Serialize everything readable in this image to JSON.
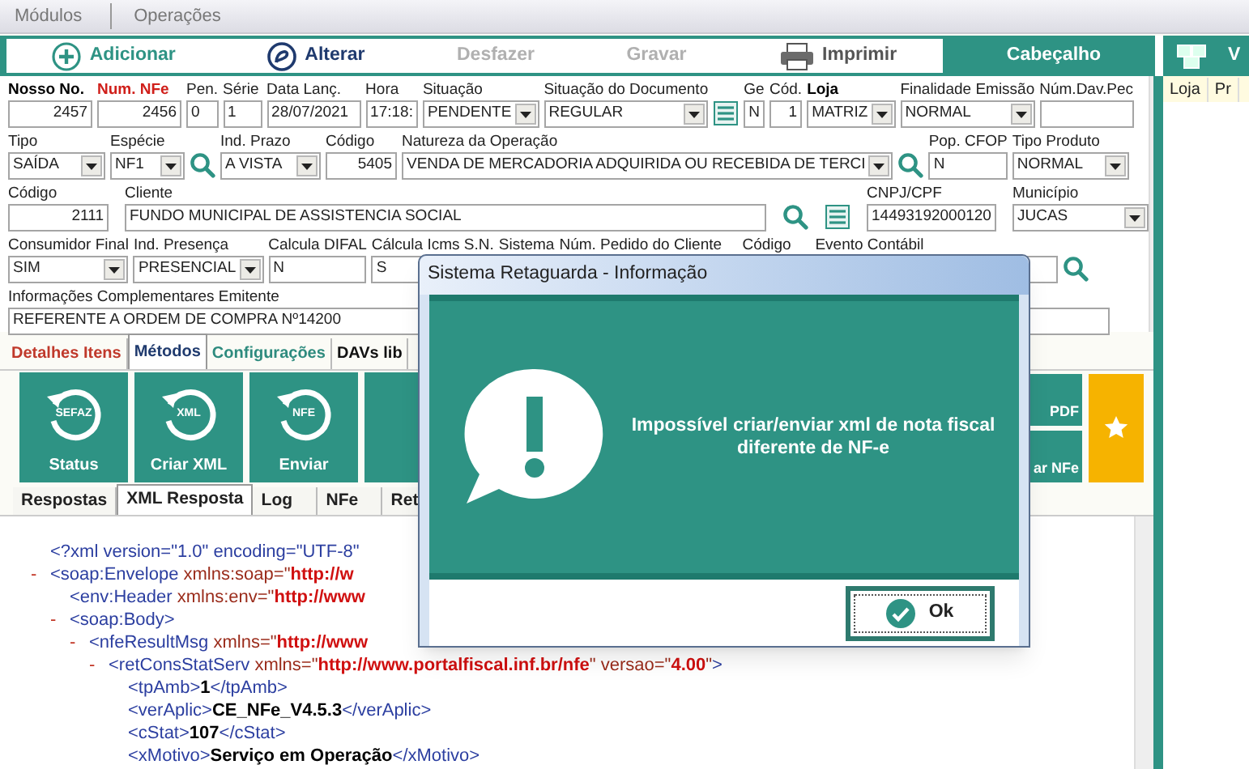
{
  "menu": [
    {
      "label": "Módulos"
    },
    {
      "label": "Operações"
    }
  ],
  "toolbar": [
    {
      "label": "Adicionar",
      "kind": "add",
      "disabled": false
    },
    {
      "label": "Alterar",
      "kind": "edit",
      "disabled": false
    },
    {
      "label": "Desfazer",
      "kind": "plain",
      "disabled": true
    },
    {
      "label": "Gravar",
      "kind": "plain",
      "disabled": true
    },
    {
      "label": "Imprimir",
      "kind": "print",
      "disabled": false
    }
  ],
  "header_tabs": [
    {
      "label": "Cabeçalho"
    },
    {
      "label": "V"
    }
  ],
  "form": [
    [
      {
        "kind": "number",
        "label": "Nosso No.",
        "bold": true,
        "value": "2457"
      },
      {
        "kind": "number",
        "label": "Num. NFe",
        "bold": true,
        "alert": true,
        "value": "2456"
      },
      {
        "kind": "text",
        "label": "Pen.",
        "value": "0"
      },
      {
        "kind": "text",
        "label": "Série",
        "value": "1"
      },
      {
        "kind": "text",
        "label": "Data Lanç.",
        "value": "28/07/2021"
      },
      {
        "kind": "text",
        "label": "Hora",
        "value": "17:18:"
      },
      {
        "kind": "select",
        "label": "Situação",
        "value": "PENDENTE"
      },
      {
        "kind": "select",
        "label": "Situação do Documento",
        "value": "REGULAR"
      },
      {
        "kind": "list"
      },
      {
        "kind": "text",
        "label": "Ge",
        "value": "N"
      },
      {
        "kind": "number",
        "label": "Cód.",
        "value": "1"
      },
      {
        "kind": "select",
        "label": "Loja",
        "bold": true,
        "value": "MATRIZ"
      },
      {
        "kind": "select",
        "label": "Finalidade Emissão",
        "value": "NORMAL"
      },
      {
        "kind": "text",
        "label": "Núm.Dav.Pec"
      }
    ],
    [
      {
        "kind": "select",
        "label": "Tipo",
        "value": "SAÍDA"
      },
      {
        "kind": "select",
        "label": "Espécie",
        "value": "NF1"
      },
      {
        "kind": "search"
      },
      {
        "kind": "select",
        "label": "Ind. Prazo",
        "value": "A VISTA"
      },
      {
        "kind": "number",
        "label": "Código",
        "value": "5405"
      },
      {
        "kind": "select",
        "label": "Natureza da Operação",
        "value": "VENDA DE MERCADORIA ADQUIRIDA OU RECEBIDA DE TERCI"
      },
      {
        "kind": "search"
      },
      {
        "kind": "text",
        "label": "Pop. CFOP",
        "value": "N"
      },
      {
        "kind": "select",
        "label": "Tipo Produto",
        "value": "NORMAL"
      }
    ],
    [
      {
        "kind": "number",
        "label": "Código",
        "value": "2111"
      },
      {
        "kind": "text",
        "label": "Cliente",
        "value": "FUNDO MUNICIPAL DE ASSISTENCIA SOCIAL"
      },
      {
        "kind": "search"
      },
      {
        "kind": "list"
      },
      {
        "kind": "text",
        "label": "CNPJ/CPF",
        "value": "14493192000120"
      },
      {
        "kind": "select",
        "label": "Município",
        "value": "JUCAS"
      }
    ],
    [
      {
        "kind": "select",
        "label": "Consumidor Final",
        "value": "SIM"
      },
      {
        "kind": "select",
        "label": "Ind. Presença",
        "value": "PRESENCIAL"
      },
      {
        "kind": "text",
        "label": "Calcula DIFAL",
        "value": "N"
      },
      {
        "kind": "text",
        "label": "Cálcula Icms S.N.",
        "value": "S"
      },
      {
        "kind": "text",
        "label": "Sistema"
      },
      {
        "kind": "text",
        "label": "Núm. Pedido do Cliente"
      },
      {
        "kind": "text",
        "label": "Código"
      },
      {
        "kind": "text",
        "label": "Evento Contábil"
      },
      {
        "kind": "search"
      }
    ],
    [
      {
        "kind": "text",
        "label": "Informações Complementares Emitente",
        "value": "REFERENTE A ORDEM DE COMPRA Nº14200"
      }
    ]
  ],
  "tabs": [
    {
      "label": "Detalhes Itens",
      "selected": false,
      "color": "#c0392b"
    },
    {
      "label": "Métodos",
      "selected": true,
      "color": "#1f3a6e"
    },
    {
      "label": "Configurações",
      "selected": false,
      "color": "#2e8b7e"
    },
    {
      "label": "DAVs lib",
      "selected": false,
      "color": "#111111"
    }
  ],
  "actions": [
    {
      "label": "Status",
      "badge": "SEFAZ"
    },
    {
      "label": "Criar XML",
      "badge": "XML"
    },
    {
      "label": "Enviar",
      "badge": "NFE"
    }
  ],
  "side_actions": [
    {
      "label": "PDF"
    },
    {
      "label": "ar NFe"
    }
  ],
  "subtabs": [
    {
      "label": "Respostas",
      "selected": false
    },
    {
      "label": "XML Resposta",
      "selected": true
    },
    {
      "label": "Log",
      "selected": false
    },
    {
      "label": "NFe",
      "selected": false
    },
    {
      "label": "Ret",
      "selected": false
    }
  ],
  "xml": [
    {
      "parts": [
        {
          "kind": "tag",
          "text": "<?xml version=\"1.0\" encoding=\"UTF-8\""
        }
      ]
    },
    {
      "toggle": "-",
      "parts": [
        {
          "kind": "tag",
          "text": "<soap:Envelope "
        },
        {
          "kind": "attr",
          "text": "xmlns:soap=\""
        },
        {
          "kind": "value",
          "text": "http://w"
        }
      ],
      "children": [
        {
          "parts": [
            {
              "kind": "tag",
              "text": "<env:Header "
            },
            {
              "kind": "attr",
              "text": "xmlns:env=\""
            },
            {
              "kind": "value",
              "text": "http://www"
            }
          ]
        },
        {
          "toggle": "-",
          "parts": [
            {
              "kind": "tag",
              "text": "<soap:Body>"
            }
          ],
          "children": [
            {
              "toggle": "-",
              "parts": [
                {
                  "kind": "tag",
                  "text": "<nfeResultMsg "
                },
                {
                  "kind": "attr",
                  "text": "xmlns=\""
                },
                {
                  "kind": "value",
                  "text": "http://www"
                }
              ],
              "children": [
                {
                  "toggle": "-",
                  "parts": [
                    {
                      "kind": "tag",
                      "text": "<retConsStatServ "
                    },
                    {
                      "kind": "attr",
                      "text": "xmlns=\""
                    },
                    {
                      "kind": "value",
                      "text": "http://www.portalfiscal.inf.br/nfe"
                    },
                    {
                      "kind": "attr",
                      "text": "\" versao=\""
                    },
                    {
                      "kind": "value",
                      "text": "4.00"
                    },
                    {
                      "kind": "attr",
                      "text": "\""
                    },
                    {
                      "kind": "tag",
                      "text": ">"
                    }
                  ],
                  "children": [
                    {
                      "parts": [
                        {
                          "kind": "tag",
                          "text": "<tpAmb>"
                        },
                        {
                          "kind": "text",
                          "text": "1"
                        },
                        {
                          "kind": "tag",
                          "text": "</tpAmb>"
                        }
                      ]
                    },
                    {
                      "parts": [
                        {
                          "kind": "tag",
                          "text": "<verAplic>"
                        },
                        {
                          "kind": "text",
                          "text": "CE_NFe_V4.5.3"
                        },
                        {
                          "kind": "tag",
                          "text": "</verAplic>"
                        }
                      ]
                    },
                    {
                      "parts": [
                        {
                          "kind": "tag",
                          "text": "<cStat>"
                        },
                        {
                          "kind": "text",
                          "text": "107"
                        },
                        {
                          "kind": "tag",
                          "text": "</cStat>"
                        }
                      ]
                    },
                    {
                      "parts": [
                        {
                          "kind": "tag",
                          "text": "<xMotivo>"
                        },
                        {
                          "kind": "text",
                          "text": "Serviço em Operação"
                        },
                        {
                          "kind": "tag",
                          "text": "</xMotivo>"
                        }
                      ]
                    }
                  ]
                }
              ]
            }
          ]
        }
      ]
    }
  ],
  "side_panel": {
    "columns": [
      "Loja",
      "Pr"
    ]
  },
  "dialog": {
    "title": "Sistema Retaguarda - Informação",
    "message": "Impossível criar/enviar xml de nota fiscal diferente de NF-e",
    "ok_label": "Ok"
  }
}
